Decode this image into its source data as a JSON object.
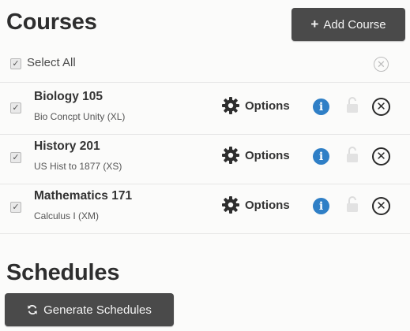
{
  "courses_section": {
    "title": "Courses",
    "add_button_label": "Add Course",
    "select_all_label": "Select All",
    "options_label": "Options",
    "items": [
      {
        "name": "Biology 105",
        "description": "Bio Concpt Unity (XL)",
        "checked": true
      },
      {
        "name": "History 201",
        "description": "US Hist to 1877 (XS)",
        "checked": true
      },
      {
        "name": "Mathematics 171",
        "description": "Calculus I (XM)",
        "checked": true
      }
    ]
  },
  "schedules_section": {
    "title": "Schedules",
    "generate_button_label": "Generate Schedules"
  },
  "icons": {
    "add": "plus-icon",
    "check": "checkmark-icon",
    "clear_all": "close-circle-icon",
    "options": "gear-icon",
    "info": "info-icon",
    "lock": "lock-icon",
    "remove": "close-circle-icon",
    "generate": "refresh-icon"
  },
  "colors": {
    "button_dark": "#4a4a4a",
    "info_blue": "#2f7fc6"
  }
}
